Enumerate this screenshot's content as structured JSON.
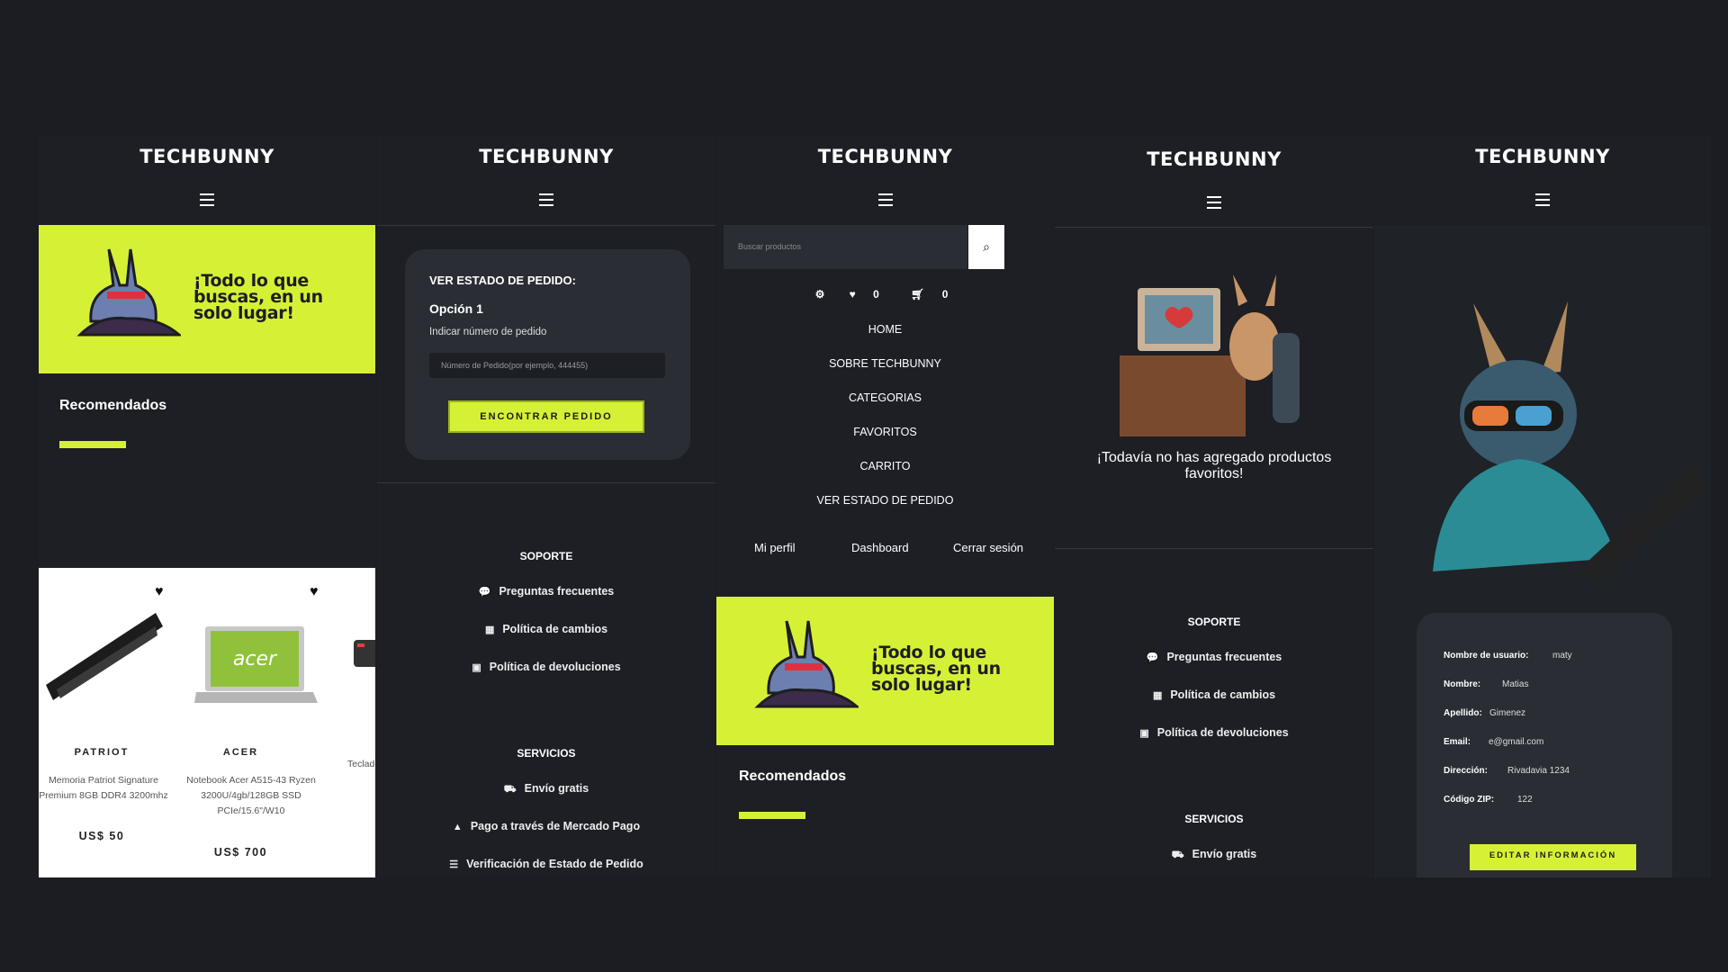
{
  "brand": "TECHBUNNY",
  "hero": {
    "line1": "¡Todo lo que",
    "line2": "buscas, en un",
    "line3": "solo lugar!"
  },
  "recommended": "Recomendados",
  "products": [
    {
      "brand": "PATRIOT",
      "name_l1": "Memoria Patriot Signature",
      "name_l2": "Premium 8GB DDR4 3200mhz",
      "price": "US$ 50"
    },
    {
      "brand": "ACER",
      "name_l1": "Notebook Acer A515-43 Ryzen",
      "name_l2": "3200U/4gb/128GB SSD",
      "name_l3": "PCIe/15.6\"/W10",
      "price": "US$ 700"
    },
    {
      "name_l1": "Teclado"
    }
  ],
  "order": {
    "title": "VER ESTADO DE PEDIDO:",
    "option": "Opción 1",
    "hint": "Indicar número de pedido",
    "placeholder": "Número de Pedido(por ejemplo, 444455)",
    "button": "ENCONTRAR PEDIDO"
  },
  "footer": {
    "support_title": "SOPORTE",
    "support": [
      "Preguntas frecuentes",
      "Política de cambios",
      "Política de devoluciones"
    ],
    "services_title": "SERVICIOS",
    "services": [
      "Envío gratis",
      "Pago a través de Mercado Pago",
      "Verificación de Estado de Pedido"
    ]
  },
  "menu": {
    "search_placeholder": "Buscar productos",
    "fav_count": "0",
    "cart_count": "0",
    "items": [
      "HOME",
      "SOBRE TECHBUNNY",
      "CATEGORIAS",
      "FAVORITOS",
      "CARRITO",
      "VER ESTADO DE PEDIDO"
    ],
    "account": [
      "Mi perfil",
      "Dashboard",
      "Cerrar sesión"
    ]
  },
  "favorites": {
    "empty_l1": "¡Todavía no has agregado productos",
    "empty_l2": "favoritos!"
  },
  "profile": {
    "fields": [
      {
        "label": "Nombre de usuario:",
        "value": "maty"
      },
      {
        "label": "Nombre:",
        "value": "Matias"
      },
      {
        "label": "Apellido:",
        "value": "Gimenez"
      },
      {
        "label": "Email:",
        "value": "e@gmail.com"
      },
      {
        "label": "Dirección:",
        "value": "Rivadavia 1234"
      },
      {
        "label": "Código ZIP:",
        "value": "122"
      }
    ],
    "button": "EDITAR INFORMACIÓN"
  },
  "colors": {
    "accent": "#d6f135",
    "background": "#1b1d22",
    "card": "#2a2d34"
  },
  "icons": [
    "hamburger-icon",
    "search-icon",
    "gear-icon",
    "heart-icon",
    "cart-icon",
    "chat-icon",
    "calendar-icon",
    "box-icon",
    "truck-icon",
    "bag-icon",
    "list-icon"
  ]
}
